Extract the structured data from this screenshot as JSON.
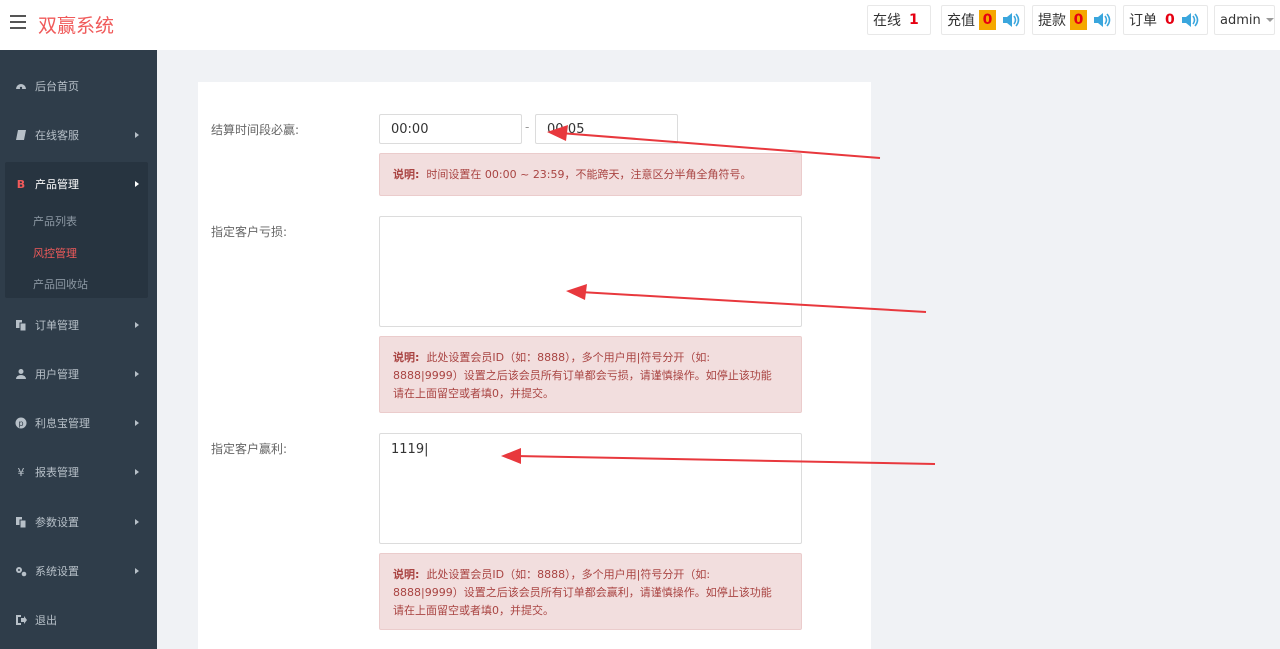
{
  "header": {
    "brand": "双赢系统",
    "online": {
      "label": "在线",
      "count": "1"
    },
    "recharge": {
      "label": "充值",
      "count": "0"
    },
    "withdraw": {
      "label": "提款",
      "count": "0"
    },
    "orders": {
      "label": "订单",
      "count": "0"
    },
    "user": "admin"
  },
  "sidebar": {
    "items": [
      {
        "label": "后台首页"
      },
      {
        "label": "在线客服"
      },
      {
        "label": "产品管理"
      },
      {
        "label": "订单管理"
      },
      {
        "label": "用户管理"
      },
      {
        "label": "利息宝管理"
      },
      {
        "label": "报表管理"
      },
      {
        "label": "参数设置"
      },
      {
        "label": "系统设置"
      },
      {
        "label": "退出"
      }
    ],
    "sub_items": [
      {
        "label": "产品列表"
      },
      {
        "label": "风控管理"
      },
      {
        "label": "产品回收站"
      }
    ]
  },
  "form": {
    "settle_time": {
      "label": "结算时间段必赢:",
      "start": "00:00",
      "separator": "-",
      "end": "00:05",
      "note_title": "说明:",
      "note": "时间设置在 00:00 ~ 23:59，不能跨天，注意区分半角全角符号。"
    },
    "loss_customers": {
      "label": "指定客户亏损:",
      "value": "",
      "note_title": "说明:",
      "note_line1": "此处设置会员ID（如：8888），多个用户用|符号分开（如:",
      "note_line2": "8888|9999）设置之后该会员所有订单都会亏损，请谨慎操作。如停止该功能",
      "note_line3": "请在上面留空或者填0，并提交。"
    },
    "win_customers": {
      "label": "指定客户赢利:",
      "value": "1119|",
      "note_title": "说明:",
      "note_line1": "此处设置会员ID（如：8888），多个用户用|符号分开（如:",
      "note_line2": "8888|9999）设置之后该会员所有订单都会赢利，请谨慎操作。如停止该功能",
      "note_line3": "请在上面留空或者填0，并提交。"
    }
  },
  "colors": {
    "brand": "#f05a5a",
    "sidebar_bg": "#2f3d4a",
    "badge_yellow": "#f5a800",
    "badge_red": "#e60012",
    "arrow": "#e8383d"
  }
}
